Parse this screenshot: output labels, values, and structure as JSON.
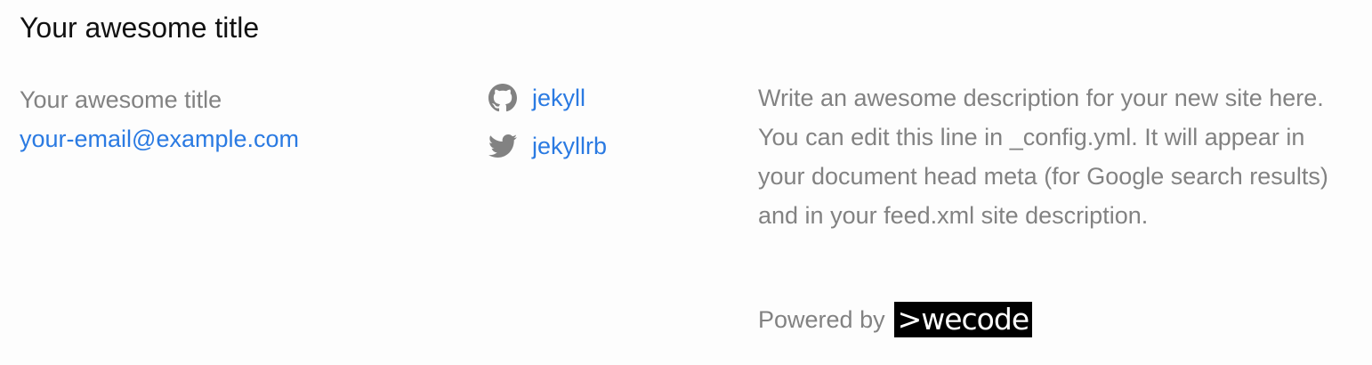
{
  "footer": {
    "heading": "Your awesome title",
    "site_name": "Your awesome title",
    "email": "your-email@example.com",
    "social": [
      {
        "icon": "github-icon",
        "label": "jekyll"
      },
      {
        "icon": "twitter-icon",
        "label": "jekyllrb"
      }
    ],
    "description": "Write an awesome description for your new site here. You can edit this line in _config.yml. It will appear in your document head meta (for Google search results) and in your feed.xml site description.",
    "powered_by_label": "Powered by",
    "powered_by_logo": ">wecode"
  },
  "colors": {
    "background": "#fdfdfd",
    "text": "#111111",
    "muted": "#828282",
    "link": "#2a7ae2",
    "logo_bg": "#000000",
    "logo_fg": "#ffffff"
  }
}
